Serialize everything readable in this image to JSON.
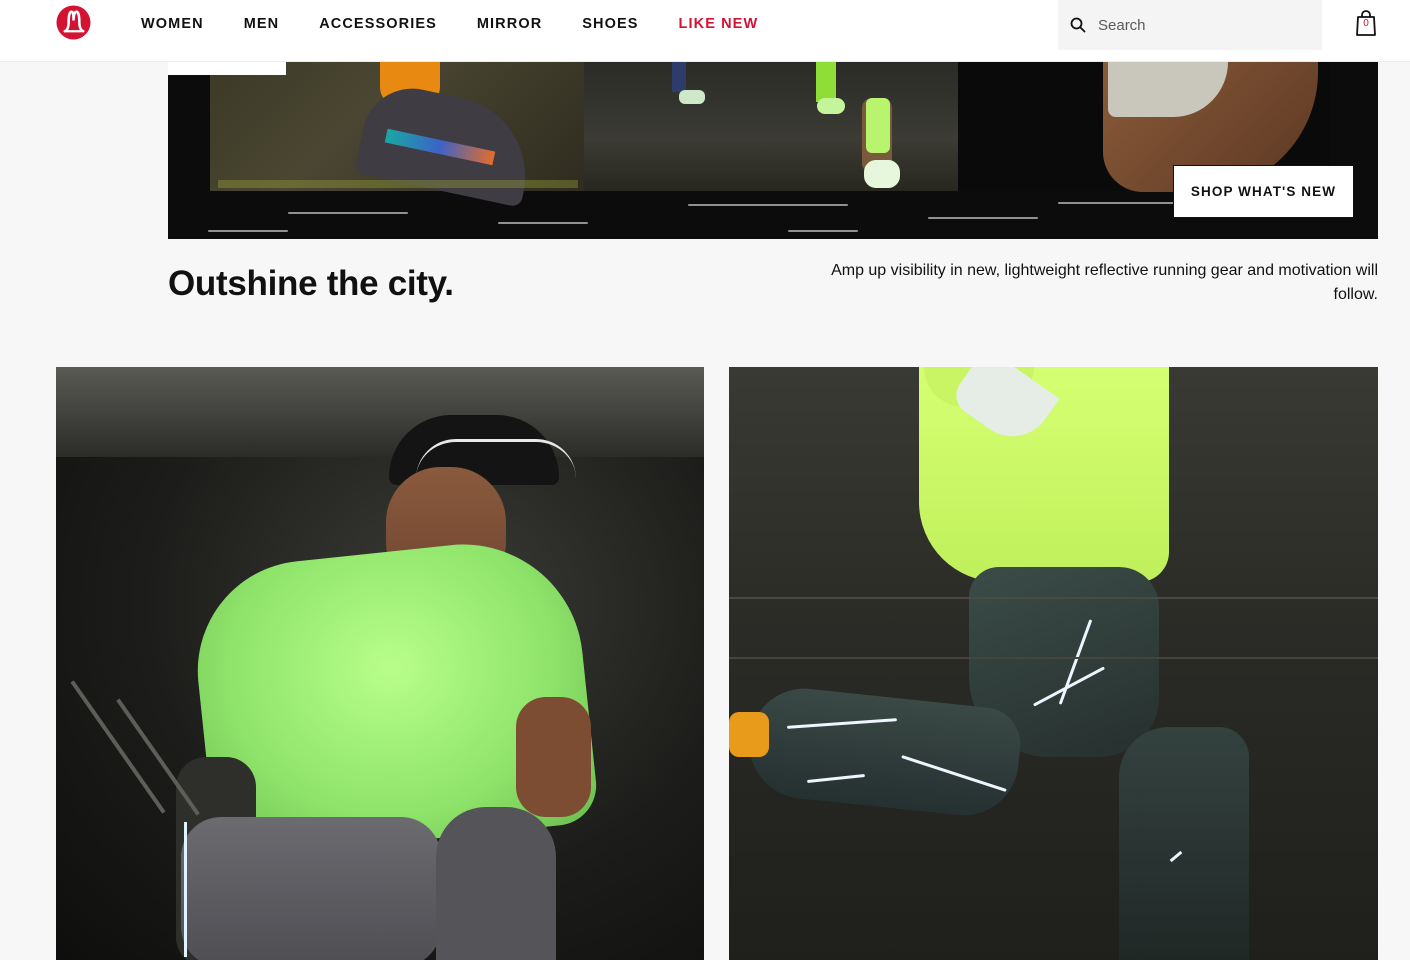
{
  "brand": {
    "name": "lululemon",
    "logo_icon": "lululemon-logo-icon",
    "color": "#d31334"
  },
  "nav": {
    "items": [
      {
        "label": "WOMEN",
        "highlight": false
      },
      {
        "label": "MEN",
        "highlight": false
      },
      {
        "label": "ACCESSORIES",
        "highlight": false
      },
      {
        "label": "MIRROR",
        "highlight": false
      },
      {
        "label": "SHOES",
        "highlight": false
      },
      {
        "label": "LIKE NEW",
        "highlight": true
      }
    ]
  },
  "search": {
    "placeholder": "Search",
    "value": "",
    "icon": "search-icon"
  },
  "bag": {
    "count": "0",
    "icon": "shopping-bag-icon"
  },
  "hero": {
    "cta_label": "SHOP WHAT'S NEW"
  },
  "copy": {
    "headline": "Outshine the city.",
    "subcopy": "Amp up visibility in new, lightweight reflective running gear and motivation will follow."
  },
  "tiles": [
    {
      "name": "runner-lime-tee",
      "alt": ""
    },
    {
      "name": "runner-reflective-tights",
      "alt": ""
    }
  ]
}
